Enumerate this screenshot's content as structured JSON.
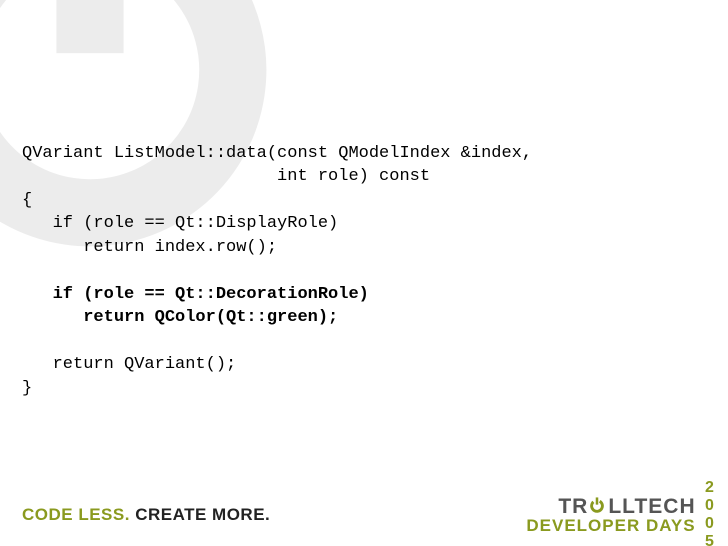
{
  "code": {
    "l1": "QVariant ListModel::data(const QModelIndex &index,",
    "l2": "                         int role) const",
    "l3": "{",
    "l4": "   if (role == Qt::DisplayRole)",
    "l5": "      return index.row();",
    "l6": "",
    "l7": "   if (role == Qt::DecorationRole)",
    "l8": "      return QColor(Qt::green);",
    "l9": "",
    "l10": "   return QVariant();",
    "l11": "}"
  },
  "footer": {
    "tagline_olive": "CODE LESS. ",
    "tagline_black": "CREATE MORE.",
    "brand_top_prefix": "TR",
    "brand_top_suffix": "LLTECH",
    "brand_bottom": "DEVELOPER DAYS",
    "brand_year": "2005"
  }
}
